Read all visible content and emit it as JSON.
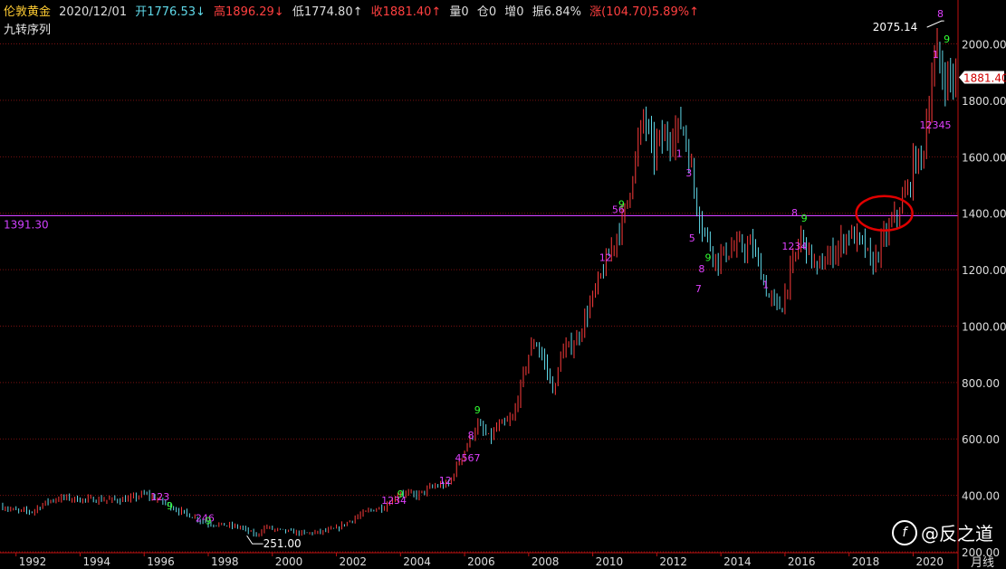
{
  "header": {
    "name": "伦敦黄金",
    "date": "2020/12/01",
    "open": "开1776.53↓",
    "high": "高1896.29↓",
    "low": "低1774.80↑",
    "close": "收1881.40↑",
    "volume": "量0",
    "position": "仓0",
    "increase": "增0",
    "amplitude": "振6.84%",
    "change": "涨(104.70)5.89%↑"
  },
  "indicator": {
    "label": "九转序列"
  },
  "period_label": "月线",
  "watermark": {
    "logo": "f",
    "text": "@反之道"
  },
  "colors": {
    "up": "#ff3c3c",
    "down": "#5fd8e8",
    "grid": "#7a1010",
    "level_line": "#d040ff",
    "nine": "#e040ff",
    "nine_green": "#33ff33",
    "circle": "#e00000"
  },
  "chart_data": {
    "type": "line",
    "title": "",
    "ylim": [
      200,
      2130
    ],
    "y_ticks": [
      200,
      400,
      600,
      800,
      1000,
      1200,
      1400,
      1600,
      1800,
      2000
    ],
    "y_tick_labels": [
      "200.00",
      "400.00",
      "600.00",
      "800.00",
      "1000.00",
      "1200.00",
      "1400.00",
      "1600.00",
      "1800.00",
      "2000.00"
    ],
    "x_ticks": [
      "1992",
      "1994",
      "1996",
      "1998",
      "2000",
      "2002",
      "2004",
      "2006",
      "2008",
      "2010",
      "2012",
      "2014",
      "2016",
      "2018",
      "2020"
    ],
    "xlim": [
      1991.5,
      2021.4
    ],
    "reference_line": {
      "value": 1391.3,
      "label": "1391.30"
    },
    "annotations": [
      {
        "x": 1999.6,
        "y": 251.0,
        "label": "251.00"
      },
      {
        "x": 2020.6,
        "y": 2075.14,
        "label": "2075.14"
      },
      {
        "x": 2020.92,
        "y": 1881.4,
        "label": "1881.40"
      }
    ],
    "highlight_circle": {
      "x": 2019.1,
      "y": 1400
    },
    "series": [
      {
        "x": [
          1991.5,
          1992.0,
          1992.5,
          1993.0,
          1993.5,
          1994.0,
          1994.5,
          1995.0,
          1995.5,
          1996.0,
          1996.5,
          1997.0,
          1997.5,
          1998.0,
          1998.5,
          1999.0,
          1999.5,
          1999.8,
          2000.0,
          2000.5,
          2001.0,
          2001.5,
          2002.0,
          2002.5,
          2003.0,
          2003.5,
          2004.0,
          2004.5,
          2005.0,
          2005.5,
          2006.0,
          2006.4,
          2006.8,
          2007.0,
          2007.5,
          2008.0,
          2008.2,
          2008.5,
          2008.8,
          2009.0,
          2009.5,
          2010.0,
          2010.5,
          2011.0,
          2011.6,
          2011.9,
          2012.0,
          2012.5,
          2012.8,
          2013.0,
          2013.3,
          2013.6,
          2013.9,
          2014.0,
          2014.5,
          2015.0,
          2015.5,
          2015.9,
          2016.0,
          2016.5,
          2017.0,
          2017.5,
          2018.0,
          2018.5,
          2018.7,
          2019.0,
          2019.5,
          2019.9,
          2020.0,
          2020.3,
          2020.6,
          2020.75,
          2020.92
        ],
        "values": [
          362,
          345,
          343,
          380,
          392,
          385,
          385,
          384,
          385,
          405,
          382,
          350,
          325,
          300,
          295,
          287,
          258,
          290,
          280,
          272,
          265,
          270,
          282,
          315,
          345,
          360,
          410,
          400,
          430,
          440,
          560,
          650,
          600,
          640,
          670,
          900,
          950,
          870,
          760,
          900,
          950,
          1100,
          1250,
          1400,
          1750,
          1600,
          1650,
          1680,
          1720,
          1600,
          1400,
          1300,
          1230,
          1250,
          1280,
          1280,
          1100,
          1060,
          1120,
          1320,
          1200,
          1260,
          1330,
          1280,
          1210,
          1290,
          1400,
          1500,
          1580,
          1600,
          1900,
          1970,
          1881
        ]
      }
    ]
  }
}
